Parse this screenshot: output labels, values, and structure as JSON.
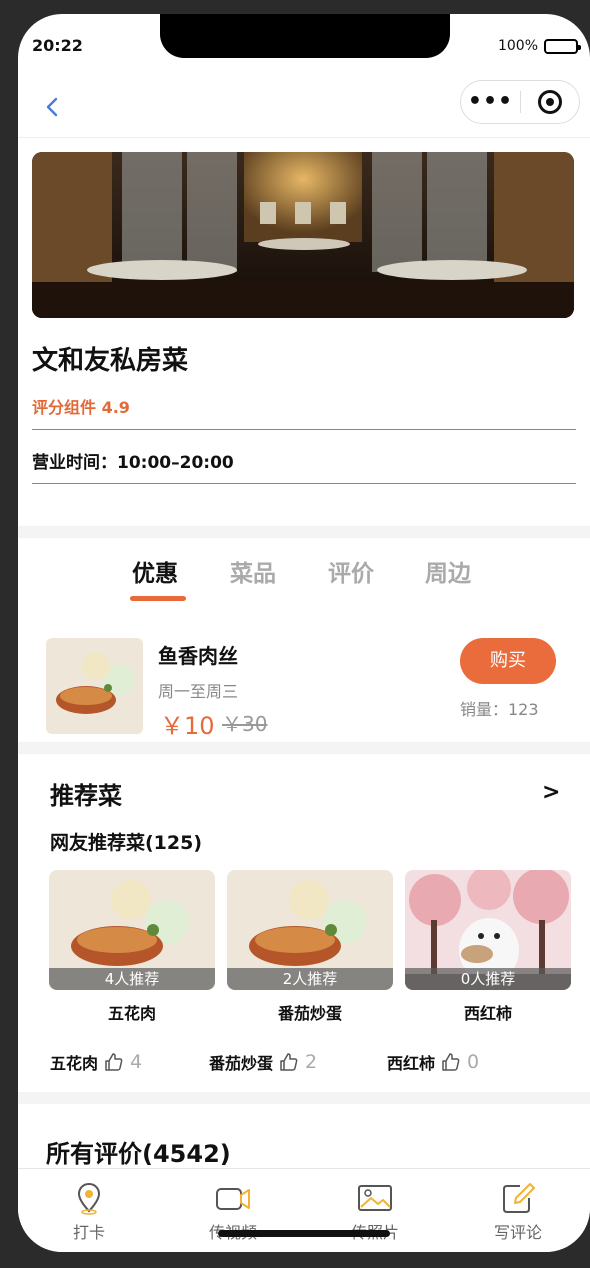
{
  "status": {
    "time": "20:22",
    "battery": "100%"
  },
  "nav": {
    "back_icon": "chevron-left-icon",
    "more_label": "•••",
    "close_icon": "target-icon"
  },
  "shop": {
    "name": "文和友私房菜",
    "rating": "评分组件 4.9",
    "hours": "营业时间：10:00–20:00"
  },
  "tabs": [
    {
      "label": "优惠",
      "active": true
    },
    {
      "label": "菜品",
      "active": false
    },
    {
      "label": "评价",
      "active": false
    },
    {
      "label": "周边",
      "active": false
    }
  ],
  "deal": {
    "title": "鱼香肉丝",
    "subtitle": "周一至周三",
    "price": "￥10",
    "original_price": "￥30",
    "buy_label": "购买",
    "sales": "销量：123"
  },
  "recommend": {
    "title": "推荐菜",
    "more": ">",
    "subtitle": "网友推荐菜(125)",
    "cards": [
      {
        "badge": "4人推荐",
        "name": "五花肉"
      },
      {
        "badge": "2人推荐",
        "name": "番茄炒蛋"
      },
      {
        "badge": "0人推荐",
        "name": "西红柿"
      }
    ],
    "likes": [
      {
        "name": "五花肉",
        "count": "4"
      },
      {
        "name": "番茄炒蛋",
        "count": "2"
      },
      {
        "name": "西红柿",
        "count": "0"
      }
    ]
  },
  "reviews": {
    "title": "所有评价(4542)"
  },
  "tabbar": [
    {
      "label": "打卡",
      "icon": "location-pin-icon"
    },
    {
      "label": "传视频",
      "icon": "video-camera-icon"
    },
    {
      "label": "传照片",
      "icon": "image-icon"
    },
    {
      "label": "写评论",
      "icon": "edit-icon"
    }
  ],
  "colors": {
    "accent": "#e8693a",
    "link": "#4a7bd8",
    "muted": "#888888"
  }
}
